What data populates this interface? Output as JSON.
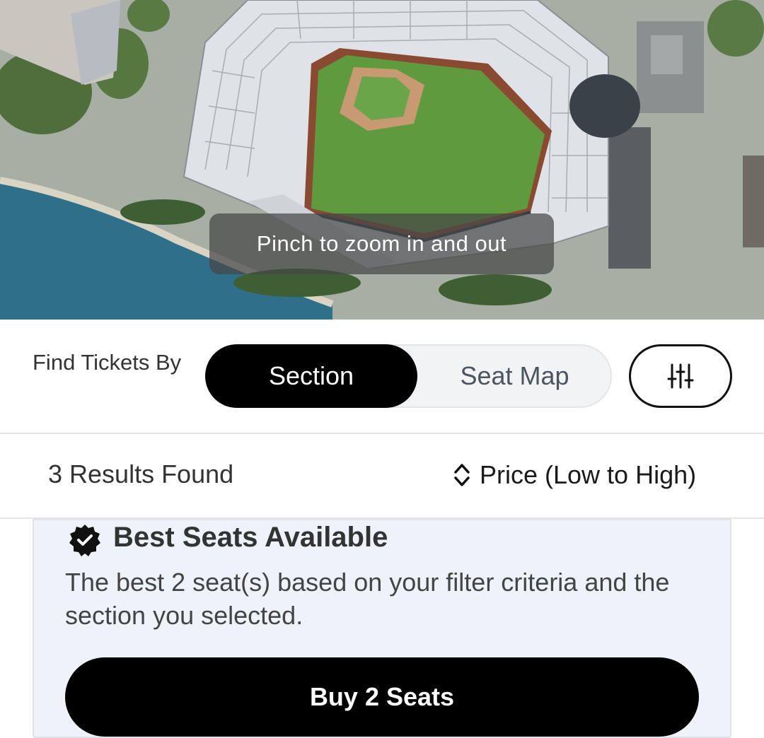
{
  "map": {
    "zoom_hint": "Pinch to zoom in and out"
  },
  "find_tickets": {
    "label": "Find Tickets By",
    "options": [
      "Section",
      "Seat Map"
    ],
    "selected": "Section",
    "filter_icon": "sliders-icon"
  },
  "results": {
    "count_text": "3 Results Found",
    "sort_label": "Price (Low to High)",
    "sort_icon": "sort-chevrons-icon"
  },
  "best_seats": {
    "icon": "verified-check-badge-icon",
    "title": "Best Seats Available",
    "description": "The best 2 seat(s) based on your filter criteria and the section you selected.",
    "button_label": "Buy 2 Seats"
  },
  "colors": {
    "primary": "#000000",
    "card_bg": "#eef2fa",
    "field_green": "#5f9a3f",
    "water": "#2f6f8a"
  }
}
